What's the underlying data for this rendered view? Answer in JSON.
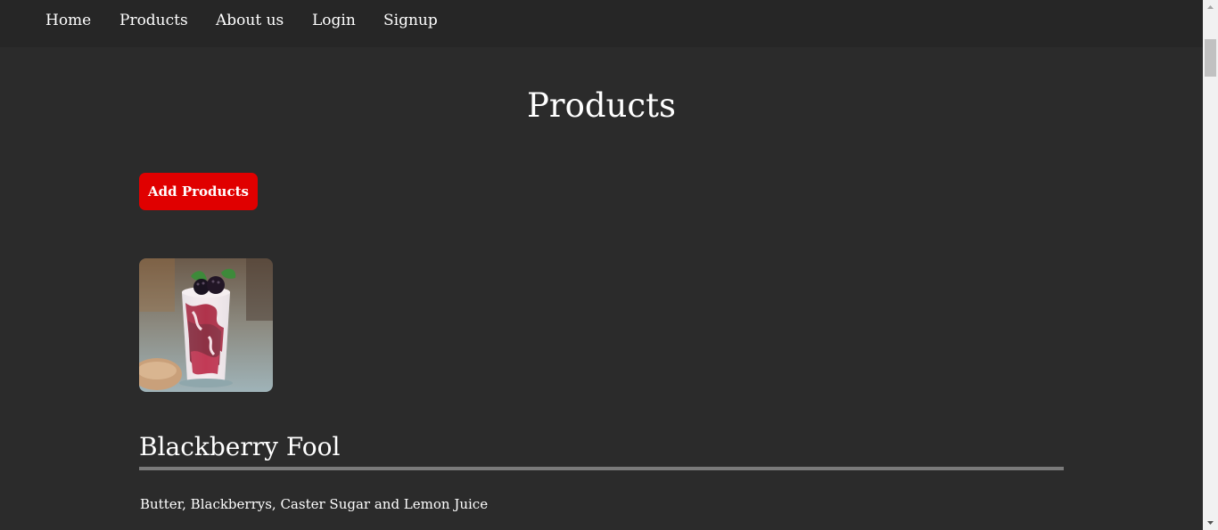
{
  "nav": {
    "items": [
      {
        "label": "Home"
      },
      {
        "label": "Products"
      },
      {
        "label": "About us"
      },
      {
        "label": "Login"
      },
      {
        "label": "Signup"
      }
    ]
  },
  "main": {
    "title": "Products",
    "add_button_label": "Add Products"
  },
  "product": {
    "image_alt": "Blackberry Fool dessert in glass",
    "name": "Blackberry Fool",
    "description": "Butter, Blackberrys, Caster Sugar and Lemon Juice"
  },
  "colors": {
    "background": "#2b2b2b",
    "navbar": "#262626",
    "accent_button": "#e00000",
    "divider": "#7a7a7a"
  },
  "icons": {
    "scroll_up": "triangle-up-icon",
    "scroll_down": "triangle-down-icon"
  }
}
